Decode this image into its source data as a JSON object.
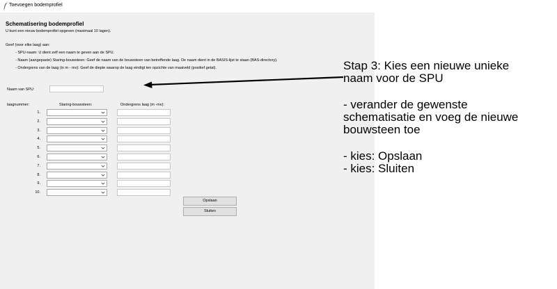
{
  "window": {
    "title": "Toevoegen bodemprofiel",
    "heading": "Schematisering bodemprofiel",
    "subtitle": "U kunt een nieuw bodemprofiel opgeven (maximaal 10 lagen).",
    "instructions_header": "Geef (voor elke laag) aan:",
    "instructions": [
      "-     SPU-naam: U dient zelf een naam te geven aan de SPU.",
      "-     Naam (aangepaste) Staring-bouwsteen: Geef de naam van de bouwsteen van betreffende laag. De naam dient in de BASIS-lijst te staan (BAS-directory).",
      "-     Ondergrens van de laag (in m - mv): Geef de diepte waarop de laag eindigt ten opzichte van maaiveld (positief getal)."
    ],
    "spu_label": "Naam van SPU:",
    "spu_value": "",
    "columns": {
      "layer_number": "laagnummer:",
      "building_block": "Staring-bouwsteen:",
      "lower_boundary": "Ondergrens laag (m -mv):"
    },
    "rows": [
      {
        "num": "1.",
        "block": "",
        "depth": ""
      },
      {
        "num": "2.",
        "block": "",
        "depth": ""
      },
      {
        "num": "3.",
        "block": "",
        "depth": ""
      },
      {
        "num": "4.",
        "block": "",
        "depth": ""
      },
      {
        "num": "5.",
        "block": "",
        "depth": ""
      },
      {
        "num": "6.",
        "block": "",
        "depth": ""
      },
      {
        "num": "7.",
        "block": "",
        "depth": ""
      },
      {
        "num": "8.",
        "block": "",
        "depth": ""
      },
      {
        "num": "9.",
        "block": "",
        "depth": ""
      },
      {
        "num": "10.",
        "block": "",
        "depth": ""
      }
    ],
    "save_label": "Opslaan",
    "close_label": "Sluiten"
  },
  "annotation": {
    "lines": [
      "Stap 3: Kies een nieuwe unieke",
      "naam voor de SPU",
      "",
      "- verander de gewenste",
      "schematisatie en voeg de nieuwe",
      "bouwsteen toe",
      "",
      "- kies: Opslaan",
      "- kies: Sluiten"
    ]
  },
  "colors": {
    "window_bg": "#f0f0f0",
    "button_bg": "#e1e1e1",
    "border": "#adadad",
    "text": "#000000"
  }
}
